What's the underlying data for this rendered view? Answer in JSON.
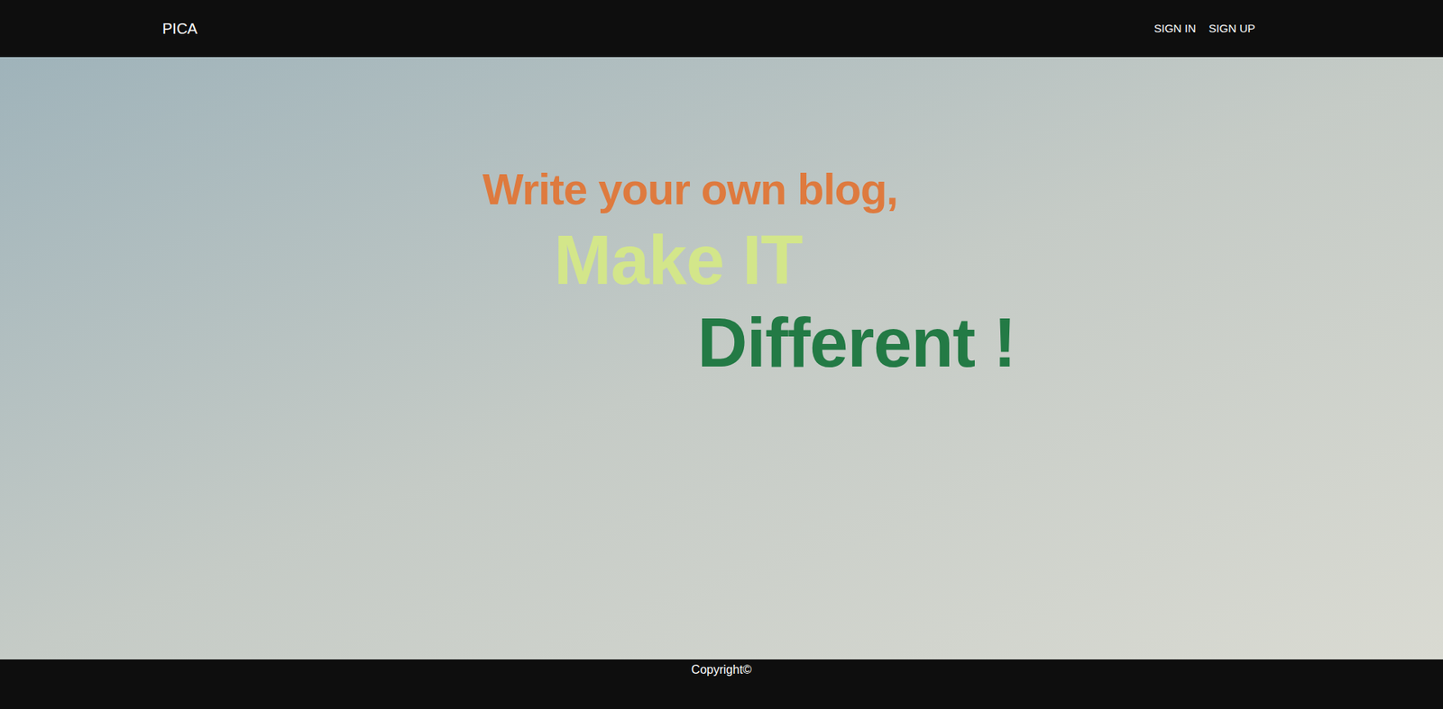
{
  "header": {
    "logo": "PICA",
    "nav": [
      {
        "label": "SIGN IN"
      },
      {
        "label": "SIGN UP"
      }
    ]
  },
  "hero": {
    "lines": [
      {
        "text": "Write your own blog,",
        "color": "#de7a3e"
      },
      {
        "text": "Make IT",
        "color": "#d3e68a"
      },
      {
        "text": "Different !",
        "color": "#237a45"
      }
    ]
  },
  "footer": {
    "text": "Copyright©"
  }
}
